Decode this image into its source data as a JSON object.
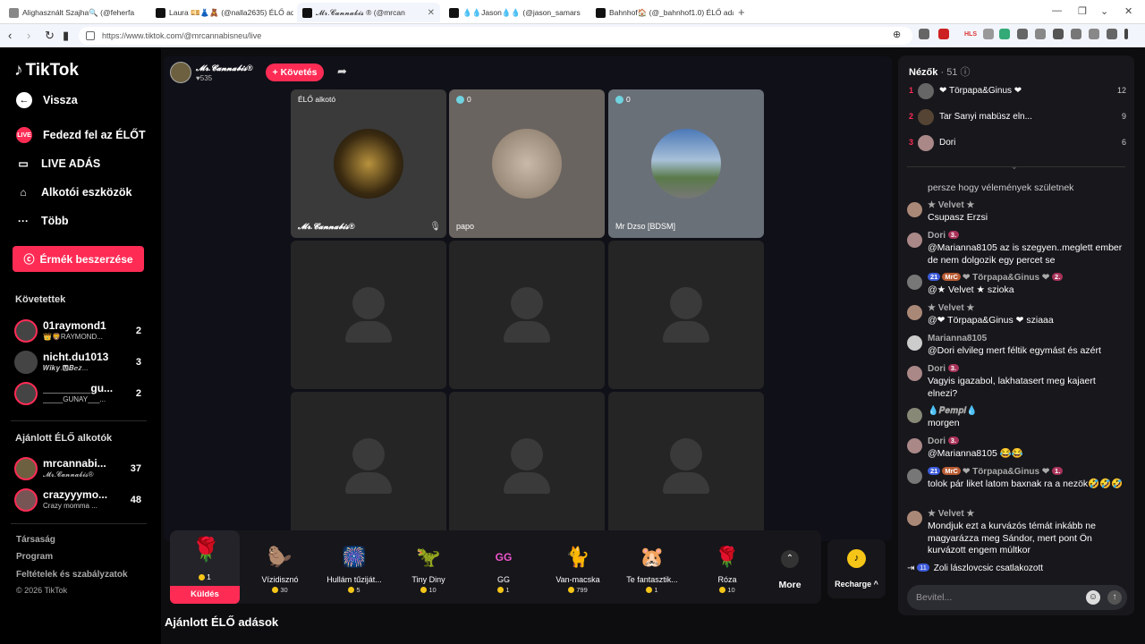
{
  "browser": {
    "tabs": [
      {
        "title": "Alighasznált Szajha🔍 (@feherfa"
      },
      {
        "title": "Laura 💴👗🧸 (@nalla2635) ÉLŐ adá"
      },
      {
        "title": "𝓜𝓻.𝓒𝓪𝓷𝓷𝓪𝓫𝓲𝓼 ® (@mrcan"
      },
      {
        "title": "💧💧Jason💧💧 (@jason_samars"
      },
      {
        "title": "Bahnhof🏠 (@_bahnhof1.0) ÉLŐ adá"
      }
    ],
    "url": "https://www.tiktok.com/@mrcannabisneu/live",
    "ext_badge": "HLS"
  },
  "sidebar": {
    "logo": "TikTok",
    "back": "Vissza",
    "nav": [
      {
        "label": "Fedezd fel az ÉLŐT",
        "icon": "live-discover-icon"
      },
      {
        "label": "LIVE ADÁS",
        "icon": "camera-icon"
      },
      {
        "label": "Alkotói eszközök",
        "icon": "creator-tools-icon"
      },
      {
        "label": "Több",
        "icon": "more-dots-icon"
      }
    ],
    "coins_button": "Érmék beszerzése",
    "following_title": "Követettek",
    "following": [
      {
        "name": "01raymond1",
        "sub": "👑🦁RAYMOND...",
        "count": "2"
      },
      {
        "name": "nicht.du1013",
        "sub": "𝑾𝒊𝒌𝒚.🅼𝑩𝒆𝒛...",
        "count": "3"
      },
      {
        "name": "________gu...",
        "sub": "_____GUNAY___...",
        "count": "2"
      }
    ],
    "recommended_title": "Ajánlott ÉLŐ alkotók",
    "recommended": [
      {
        "name": "mrcannabi...",
        "sub": "𝓜𝓻.𝓒𝓪𝓷𝓷𝓪𝓫𝓲𝓼®",
        "count": "37"
      },
      {
        "name": "crazyyymo...",
        "sub": "Crazy momma ...",
        "count": "48"
      }
    ],
    "footer": [
      "Társaság",
      "Program",
      "Feltételek és szabályzatok",
      "© 2026 TikTok"
    ]
  },
  "stream": {
    "host_name": "𝓜𝓻.𝓒𝓪𝓷𝓷𝓪𝓫𝓲𝓼®",
    "host_likes": "♥535",
    "follow": "+ Követés",
    "cells": [
      {
        "top": "ÉLŐ alkotó",
        "label": "𝓜𝓻.𝓒𝓪𝓷𝓷𝓪𝓫𝓲𝓼®"
      },
      {
        "top": "0",
        "label": "papo"
      },
      {
        "top": "0",
        "label": "Mr Dzso [BDSM]"
      }
    ],
    "recommended_streams": "Ajánlott ÉLŐ adások"
  },
  "gifts": {
    "send_count": "1",
    "send_label": "Küldés",
    "items": [
      {
        "name": "Vízidisznó",
        "price": "30",
        "icon": "🦫"
      },
      {
        "name": "Hullám tűziját...",
        "price": "5",
        "icon": "🎆"
      },
      {
        "name": "Tiny Diny",
        "price": "10",
        "icon": "🦖"
      },
      {
        "name": "GG",
        "price": "1",
        "icon": "GG"
      },
      {
        "name": "Van-macska",
        "price": "799",
        "icon": "🐈"
      },
      {
        "name": "Te fantasztik...",
        "price": "1",
        "icon": "🐹"
      },
      {
        "name": "Róza",
        "price": "10",
        "icon": "🌹"
      }
    ],
    "more": "More",
    "recharge": "Recharge ^"
  },
  "chat": {
    "viewers_label": "Nézők",
    "viewers_count": "· 51",
    "top_viewers": [
      {
        "rank": "1",
        "name": "❤ Törpapa&Ginus ❤",
        "score": "12"
      },
      {
        "rank": "2",
        "name": "Tar Sanyi mabüsz eln...",
        "score": "9"
      },
      {
        "rank": "3",
        "name": "Dori",
        "score": "6"
      }
    ],
    "partial_text": "persze hogy vélemények születnek",
    "messages": [
      {
        "name": "★ Velvet ★",
        "badges": [],
        "text": "Csupasz Erzsi"
      },
      {
        "name": "Dori",
        "badges": [
          "3."
        ],
        "text": "@Marianna8105 az is szegyen..meglett ember de nem dolgozik egy percet se"
      },
      {
        "name": "❤ Törpapa&Ginus ❤",
        "badges": [
          "21",
          "MrC",
          "2."
        ],
        "text": "@★ Velvet ★ szioka"
      },
      {
        "name": "★ Velvet ★",
        "badges": [],
        "text": "@❤ Törpapa&Ginus ❤ sziaaa"
      },
      {
        "name": "Marianna8105",
        "badges": [],
        "text": "@Dori elvileg mert féltik egymást és azért"
      },
      {
        "name": "Dori",
        "badges": [
          "3."
        ],
        "text": "Vagyis igazabol, lakhatasert meg kajaert elnezi?"
      },
      {
        "name": "💧𝑷𝒆𝒎𝒑𝒊💧",
        "badges": [],
        "text": "morgen"
      },
      {
        "name": "Dori",
        "badges": [
          "3."
        ],
        "text": "@Marianna8105 😂😂"
      },
      {
        "name": "❤ Törpapa&Ginus ❤",
        "badges": [
          "21",
          "MrC",
          "1."
        ],
        "text": "tolok pár liket latom baxnak ra a nezök🤣🤣🤣"
      },
      {
        "name": "★ Velvet ★",
        "badges": [],
        "text": "Mondjuk ezt a kurvázós témát inkább ne magyarázza meg Sándor, mert pont Ön kurvázott engem múltkor"
      }
    ],
    "join_badge": "11",
    "join_text": "Zoli lászlovcsic csatlakozott",
    "input_placeholder": "Bevitel..."
  }
}
